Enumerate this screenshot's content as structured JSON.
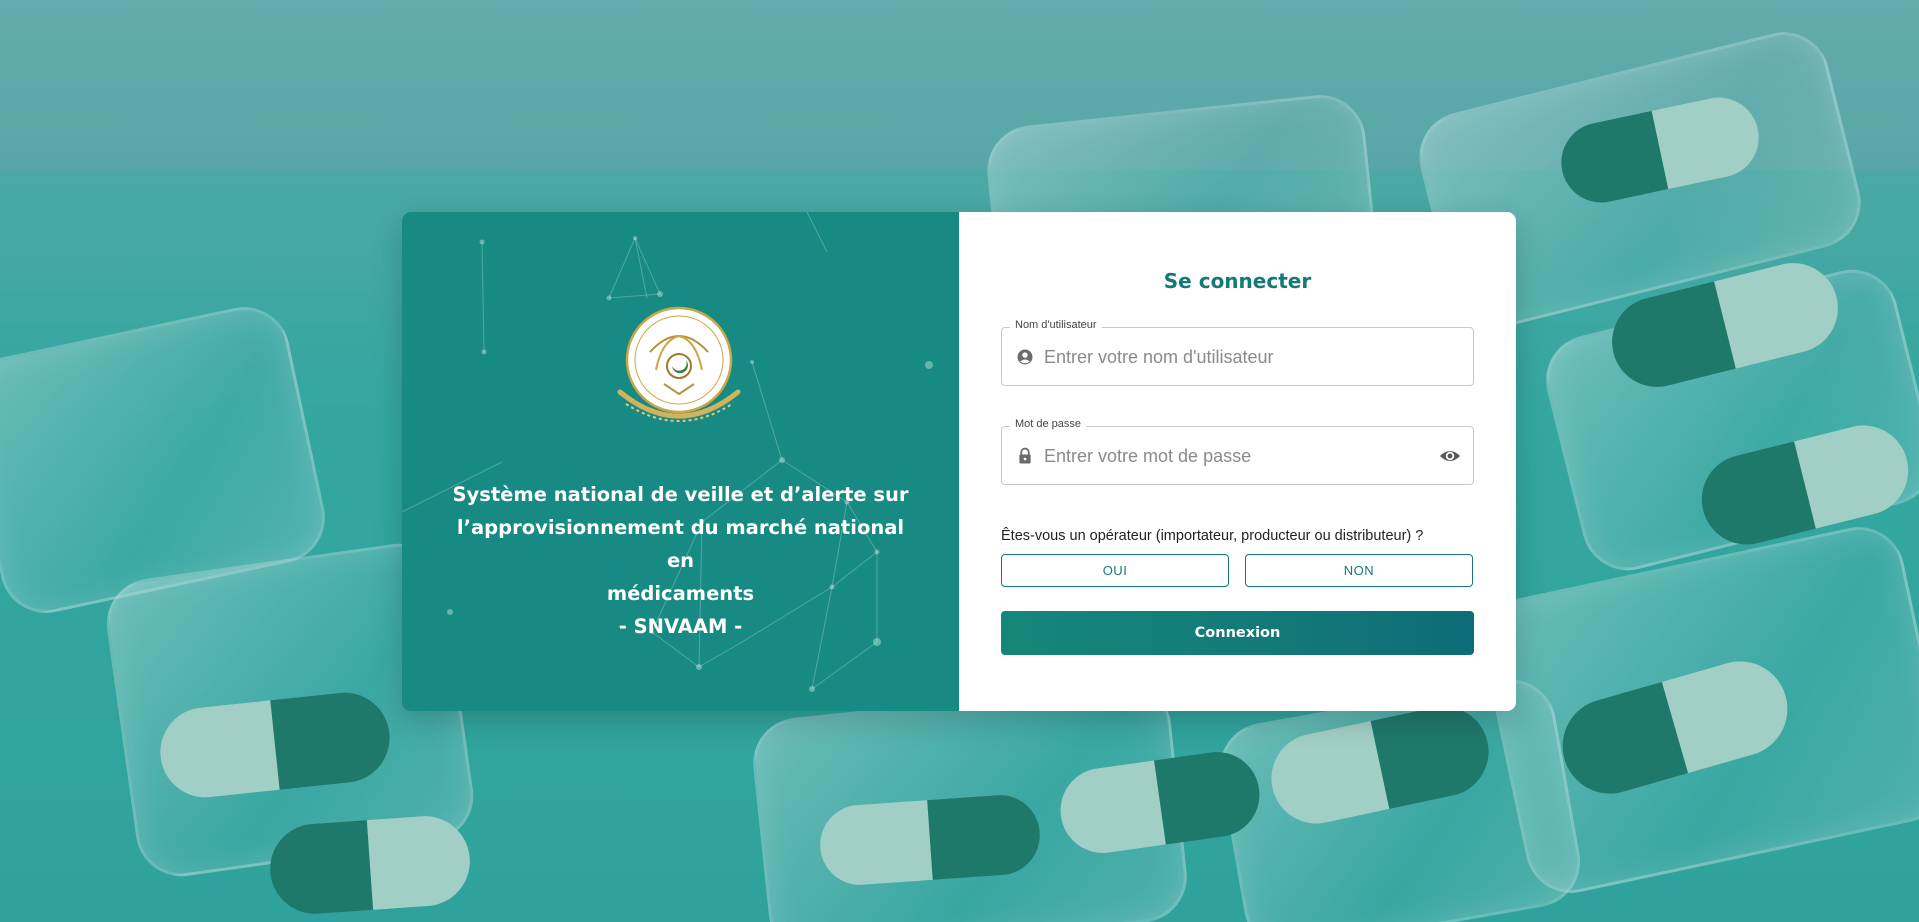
{
  "branding": {
    "emblem_icon": "national-emblem-seal-icon",
    "headline_lines": [
      "Système national de veille et d’alerte sur",
      "l’approvisionnement du marché national en",
      "médicaments",
      "- SNVAAM -"
    ],
    "panel_color": "#178a83"
  },
  "login": {
    "title": "Se connecter",
    "username": {
      "label": "Nom d'utilisateur",
      "placeholder": "Entrer votre nom d'utilisateur",
      "value": "",
      "icon": "account-circle-icon"
    },
    "password": {
      "label": "Mot de passe",
      "placeholder": "Entrer votre mot de passe",
      "value": "",
      "icon": "lock-icon",
      "toggle_icon": "eye-icon"
    },
    "operator_question": "Êtes-vous un opérateur (importateur, producteur ou distributeur) ?",
    "yes_label": "OUI",
    "no_label": "NON",
    "submit_label": "Connexion",
    "accent_color": "#137a78"
  }
}
